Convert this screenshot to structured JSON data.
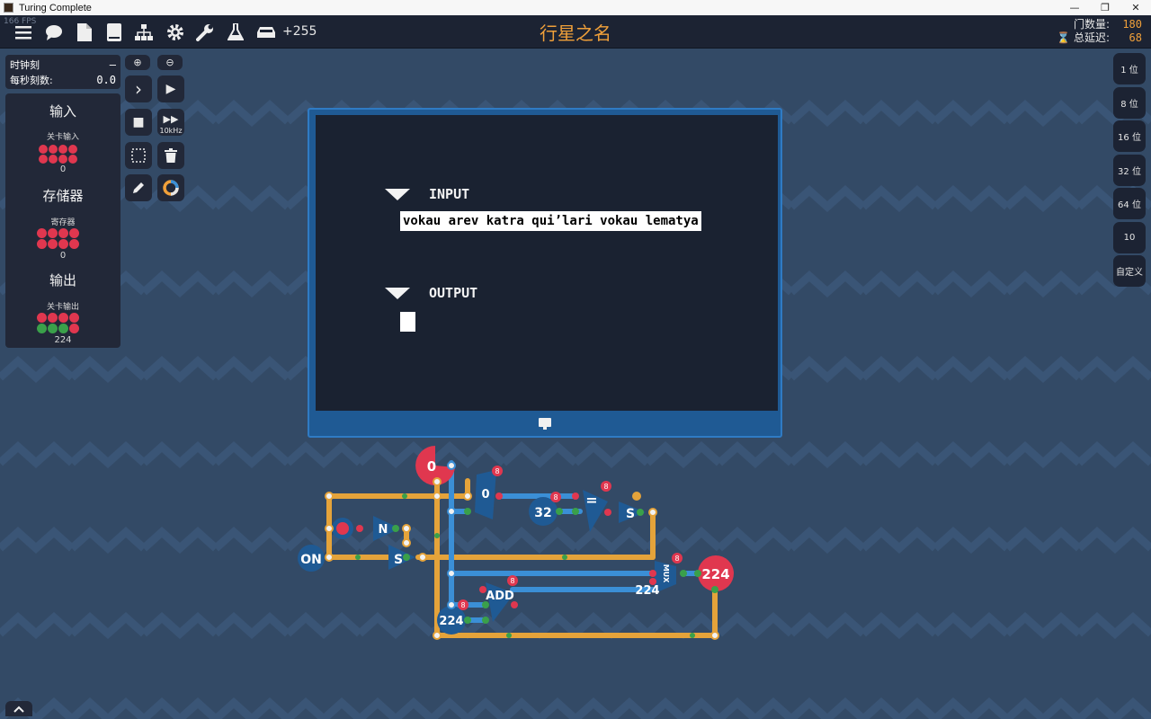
{
  "window": {
    "title": "Turing Complete",
    "controls": {
      "minimize": "—",
      "restore": "❐",
      "close": "✕"
    }
  },
  "topbar": {
    "fps": "166 FPS",
    "icons": [
      "menu-icon",
      "chat-icon",
      "document-icon",
      "book-icon",
      "hierarchy-icon",
      "gear-icon",
      "wrench-icon",
      "flask-icon",
      "inbox-tray-icon"
    ],
    "points": "+255",
    "level_title": "行星之名",
    "gate_count_label": "门数量:",
    "gate_count_value": "180",
    "delay_label": "⌛ 总延迟:",
    "delay_value": "68"
  },
  "clock": {
    "tick_label": "时钟刻",
    "tick_value": "–",
    "tps_label": "每秒刻数:",
    "tps_value": "0.0"
  },
  "components": {
    "input_title": "输入",
    "input_sub": "关卡输入",
    "input_value": "0",
    "storage_title": "存储器",
    "storage_sub": "寄存器",
    "storage_value": "0",
    "output_title": "输出",
    "output_sub": "关卡输出",
    "output_value": "224"
  },
  "tools": {
    "zoom_in": "⊕",
    "zoom_out": "⊖",
    "step": "›",
    "play": "▶",
    "stop": "■",
    "fast": "▶▶",
    "fast_label": "10kHz",
    "select": "⬚",
    "delete": "🗑",
    "pencil": "✎",
    "color": "◯"
  },
  "bit_panel": [
    "1 位",
    "8 位",
    "16 位",
    "32 位",
    "64 位",
    "10",
    "自定义"
  ],
  "console": {
    "input_header": "INPUT",
    "input_text": "vokau arev katra qui’lari vokau lematya",
    "output_header": "OUTPUT",
    "output_text": ""
  },
  "circuit": {
    "labels": {
      "top_red": "0",
      "reg_zero": "0",
      "const32": "32",
      "eq": "=",
      "switch_s1": "S",
      "switch_s2": "S",
      "not_n": "N",
      "on": "ON",
      "mux": "MUX",
      "out224": "224",
      "add": "ADD",
      "add_out": "224",
      "mux_in": "224",
      "badge": "8"
    }
  },
  "colors": {
    "accent": "#f0a03a",
    "wire_orange": "#e5a33a",
    "wire_blue": "#3b8fd6",
    "red": "#e0374f",
    "green": "#3aa04a",
    "background": "#334a66",
    "panel": "#222838"
  }
}
